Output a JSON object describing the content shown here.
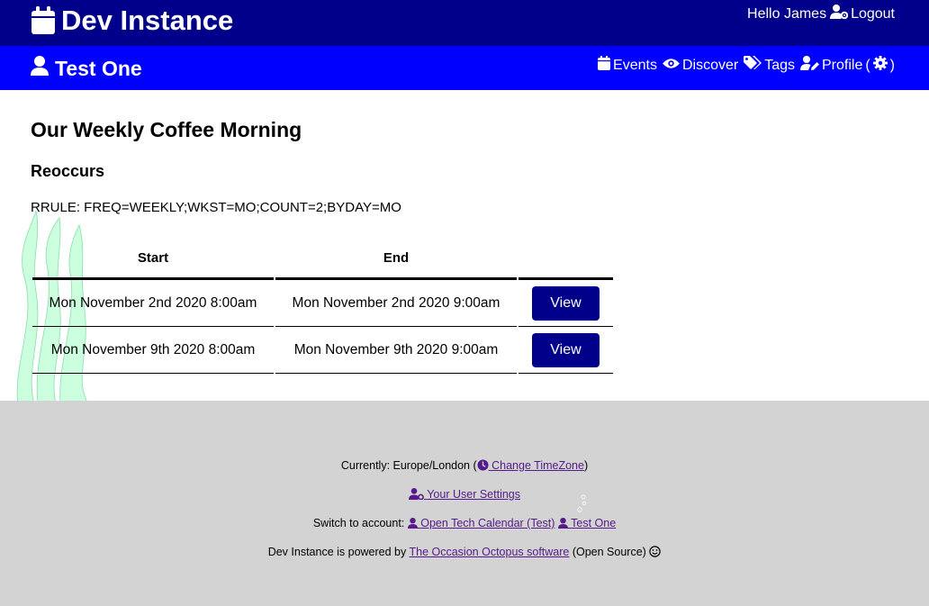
{
  "header": {
    "site_title": "Dev Instance",
    "greeting": "Hello James",
    "logout_label": "Logout"
  },
  "account_bar": {
    "title": "Test One",
    "nav": {
      "events": "Events",
      "discover": "Discover",
      "tags": "Tags",
      "profile": "Profile",
      "profile_open": "(",
      "profile_close": ")"
    }
  },
  "event": {
    "title": "Our Weekly Coffee Morning",
    "section_heading": "Reoccurs",
    "rrule": "RRULE: FREQ=WEEKLY;WKST=MO;COUNT=2;BYDAY=MO"
  },
  "occurrences": {
    "headers": {
      "start": "Start",
      "end": "End",
      "action": ""
    },
    "rows": [
      {
        "start": "Mon November 2nd 2020 8:00am",
        "end": "Mon November 2nd 2020 9:00am",
        "action": "View"
      },
      {
        "start": "Mon November 9th 2020 8:00am",
        "end": "Mon November 9th 2020 9:00am",
        "action": "View"
      }
    ]
  },
  "footer": {
    "timezone_prefix": "Currently: Europe/London (",
    "timezone_link": "Change TimeZone",
    "timezone_suffix": ")",
    "user_settings_link": "Your User Settings",
    "switch_prefix": "Switch to account:",
    "account_links": [
      "Open Tech Calendar (Test)",
      "Test One"
    ],
    "powered_prefix": "Dev Instance is powered by",
    "powered_link": "The Occasion Octopus software",
    "powered_suffix": "(Open Source)"
  },
  "colors": {
    "header_bg": "#00008b",
    "subbar_bg": "#0000ff",
    "button_bg": "#00008b",
    "footer_bg": "#d3d3d3",
    "link": "#551a8b",
    "decoration": "#ccffdd"
  },
  "icons": {
    "site": "calendar-icon",
    "logout": "user-cog-icon",
    "account": "user-icon",
    "events": "calendar-icon",
    "discover": "eye-icon",
    "tags": "tags-icon",
    "profile_edit": "user-edit-icon",
    "profile_settings": "cog-icon",
    "timezone": "clock-icon",
    "settings": "user-cog-icon",
    "smile": "smile-icon"
  }
}
